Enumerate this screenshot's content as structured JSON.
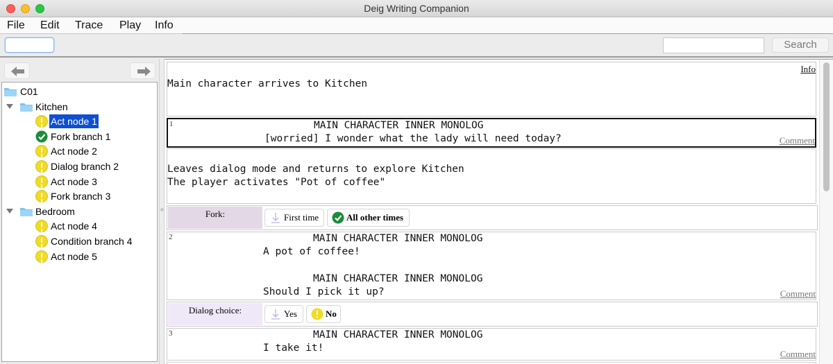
{
  "window": {
    "title": "Deig Writing Companion"
  },
  "menu": [
    "File",
    "Edit",
    "Trace",
    "Play",
    "Info"
  ],
  "toolbar": {
    "left_field_value": "",
    "search_value": "",
    "search_button": "Search"
  },
  "navigation": {
    "back_icon": "arrow-left-icon",
    "forward_icon": "arrow-right-icon"
  },
  "tree": {
    "root": "C01",
    "groups": [
      {
        "label": "Kitchen",
        "expanded": true,
        "items": [
          {
            "label": "Act node 1",
            "status": "warning",
            "selected": true
          },
          {
            "label": "Fork branch 1",
            "status": "ok",
            "selected": false
          },
          {
            "label": "Act node 2",
            "status": "warning",
            "selected": false
          },
          {
            "label": "Dialog branch 2",
            "status": "warning",
            "selected": false
          },
          {
            "label": "Act node 3",
            "status": "warning",
            "selected": false
          },
          {
            "label": "Fork branch 3",
            "status": "warning",
            "selected": false
          }
        ]
      },
      {
        "label": "Bedroom",
        "expanded": true,
        "items": [
          {
            "label": "Act node 4",
            "status": "warning",
            "selected": false
          },
          {
            "label": "Condition branch 4",
            "status": "warning",
            "selected": false
          },
          {
            "label": "Act node 5",
            "status": "warning",
            "selected": false
          }
        ]
      }
    ]
  },
  "script": {
    "info_link": "Info",
    "comment_link": "Comment",
    "intro": "Main character arrives to Kitchen",
    "nodes": [
      {
        "number": "1",
        "speaker": "MAIN CHARACTER INNER MONOLOG",
        "line": "[worried] I wonder what the lady will need today?"
      },
      {
        "number": "2",
        "speaker": "MAIN CHARACTER INNER MONOLOG",
        "line": "A pot of coffee!",
        "speaker2": "MAIN CHARACTER INNER MONOLOG",
        "line2": "Should I pick it up?"
      },
      {
        "number": "3",
        "speaker": "MAIN CHARACTER INNER MONOLOG",
        "line": "I take it!"
      }
    ],
    "narration": [
      "Leaves dialog mode and returns to explore Kitchen",
      "The player activates \"Pot of coffee\""
    ],
    "fork": {
      "label": "Fork:",
      "options": [
        {
          "label": "First time",
          "icon": "arrow-down-icon"
        },
        {
          "label": "All other times",
          "icon": "check-icon"
        }
      ],
      "color": "#e3d8e6"
    },
    "dialog_choice": {
      "label": "Dialog choice:",
      "options": [
        {
          "label": "Yes",
          "icon": "arrow-down-icon"
        },
        {
          "label": "No",
          "icon": "warning-icon"
        }
      ],
      "color": "#efe8f8"
    },
    "partial_link": "Info"
  },
  "colors": {
    "selection": "#0f4fd1",
    "warning": "#f0dc26",
    "ok": "#1a8c3a",
    "folder": "#7cc4f0"
  }
}
